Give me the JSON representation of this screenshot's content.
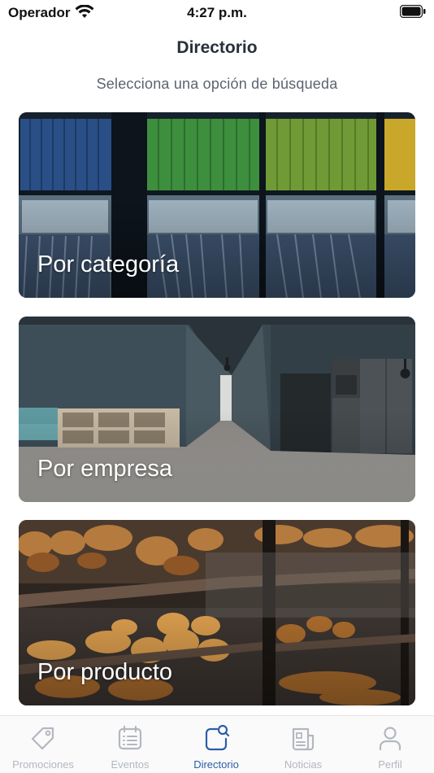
{
  "status_bar": {
    "carrier": "Operador",
    "time": "4:27 p.m."
  },
  "header": {
    "title": "Directorio",
    "subtitle": "Selecciona una opción de búsqueda"
  },
  "options": [
    {
      "label": "Por categoría"
    },
    {
      "label": "Por empresa"
    },
    {
      "label": "Por producto"
    }
  ],
  "tabs": [
    {
      "label": "Promociones",
      "icon": "tag-icon"
    },
    {
      "label": "Eventos",
      "icon": "calendar-list-icon"
    },
    {
      "label": "Directorio",
      "icon": "directory-search-icon",
      "active": true
    },
    {
      "label": "Noticias",
      "icon": "news-icon"
    },
    {
      "label": "Perfil",
      "icon": "profile-icon"
    }
  ],
  "colors": {
    "accent": "#2b5ea8",
    "inactive": "#b3b7bf",
    "title": "#2a2f3a"
  }
}
